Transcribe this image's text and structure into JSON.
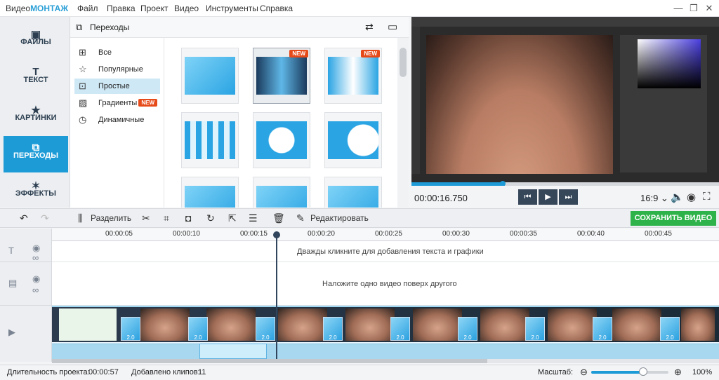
{
  "app": {
    "name_part1": "Видео",
    "name_part2": "МОНТАЖ"
  },
  "menu": [
    "Файл",
    "Правка",
    "Проект",
    "Видео",
    "Инструменты",
    "Справка"
  ],
  "window_buttons": [
    "—",
    "❐",
    "✕"
  ],
  "sidebar": [
    {
      "label": "ФАЙЛЫ",
      "icon": "image-icon",
      "active": false
    },
    {
      "label": "ТЕКСТ",
      "icon": "text-icon",
      "active": false
    },
    {
      "label": "КАРТИНКИ",
      "icon": "star-icon",
      "active": false
    },
    {
      "label": "ПЕРЕХОДЫ",
      "icon": "transitions-icon",
      "active": true
    },
    {
      "label": "ЭФФЕКТЫ",
      "icon": "magic-wand-icon",
      "active": false
    }
  ],
  "panel": {
    "title": "Переходы"
  },
  "categories": [
    {
      "label": "Все",
      "active": false
    },
    {
      "label": "Популярные",
      "active": false
    },
    {
      "label": "Простые",
      "active": true
    },
    {
      "label": "Градиенты",
      "active": false,
      "badge": "NEW"
    },
    {
      "label": "Динамичные",
      "active": false
    }
  ],
  "thumbs_badge": "NEW",
  "player": {
    "timecode": "00:00:16.750",
    "ratio": "16:9 ⌄",
    "progress_percent": 30
  },
  "toolbar": {
    "split_label": "Разделить",
    "edit_label": "Редактировать",
    "save_label": "СОХРАНИТЬ ВИДЕО"
  },
  "ruler": [
    "00:00:05",
    "00:00:10",
    "00:00:15",
    "00:00:20",
    "00:00:25",
    "00:00:30",
    "00:00:35",
    "00:00:40",
    "00:00:45"
  ],
  "timeline": {
    "text_hint": "Дважды кликните для добавления текста и графики",
    "overlay_hint": "Наложите одно видео поверх другого",
    "transition_duration": "2.0"
  },
  "status": {
    "duration_label": "Длительность проекта:",
    "duration_value": "00:00:57",
    "clips_label": "Добавлено клипов:",
    "clips_value": "11",
    "zoom_label": "Масштаб:",
    "zoom_value": "100%"
  },
  "colors": {
    "accent": "#1d9bd7",
    "save": "#2eb24a",
    "new_badge": "#e64a19"
  }
}
